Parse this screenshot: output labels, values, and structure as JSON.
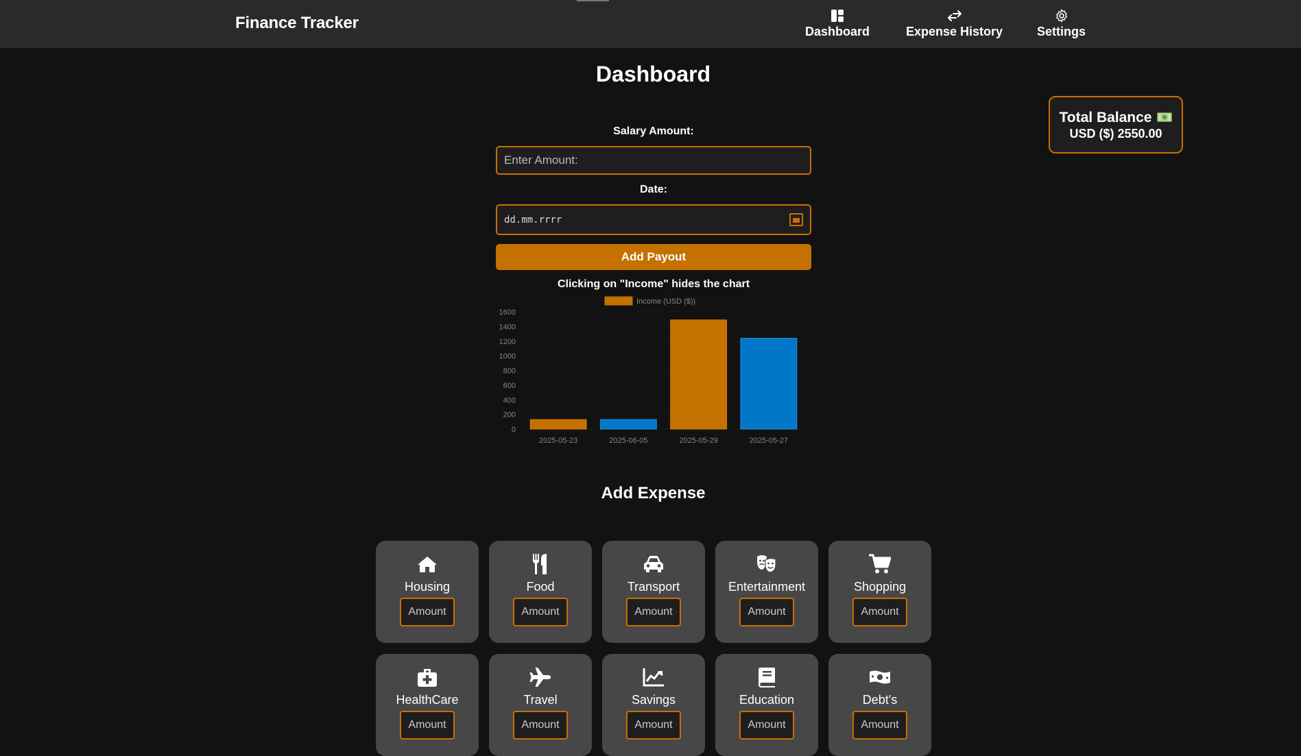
{
  "app": {
    "title": "Finance Tracker"
  },
  "nav": [
    {
      "label": "Dashboard",
      "icon": "dashboard-icon"
    },
    {
      "label": "Expense History",
      "icon": "transfer-icon"
    },
    {
      "label": "Settings",
      "icon": "gear-icon"
    }
  ],
  "page": {
    "title": "Dashboard"
  },
  "balance": {
    "title": "Total Balance",
    "icon": "money-bill-icon",
    "value": "USD ($) 2550.00"
  },
  "form": {
    "salary_label": "Salary Amount:",
    "salary_placeholder": "Enter Amount:",
    "date_label": "Date:",
    "date_placeholder": "dd.mm.rrrr",
    "submit_label": "Add Payout",
    "chart_hint": "Clicking on \"Income\" hides the chart"
  },
  "colors": {
    "accent": "#c47100",
    "blue": "#0077c8",
    "bg": "#121212",
    "card": "#474747"
  },
  "chart_data": {
    "type": "bar",
    "legend": "Income (USD ($))",
    "categories": [
      "2025-05-23",
      "2025-06-05",
      "2025-05-29",
      "2025-05-27"
    ],
    "values": [
      130,
      130,
      1490,
      1240
    ],
    "bar_colors": [
      "#c47100",
      "#0077c8",
      "#c47100",
      "#0077c8"
    ],
    "ylim": [
      0,
      1600
    ],
    "yticks": [
      "0",
      "200",
      "400",
      "600",
      "800",
      "1000",
      "1200",
      "1400",
      "1600"
    ],
    "grid": true
  },
  "expense": {
    "title": "Add Expense",
    "amount_label": "Amount",
    "categories": [
      {
        "label": "Housing",
        "icon": "house-icon"
      },
      {
        "label": "Food",
        "icon": "utensils-icon"
      },
      {
        "label": "Transport",
        "icon": "car-icon"
      },
      {
        "label": "Entertainment",
        "icon": "masks-theater-icon"
      },
      {
        "label": "Shopping",
        "icon": "cart-icon"
      },
      {
        "label": "HealthCare",
        "icon": "medical-kit-icon"
      },
      {
        "label": "Travel",
        "icon": "plane-icon"
      },
      {
        "label": "Savings",
        "icon": "chart-line-icon"
      },
      {
        "label": "Education",
        "icon": "book-icon"
      },
      {
        "label": "Debt's",
        "icon": "money-bill-icon"
      }
    ]
  }
}
